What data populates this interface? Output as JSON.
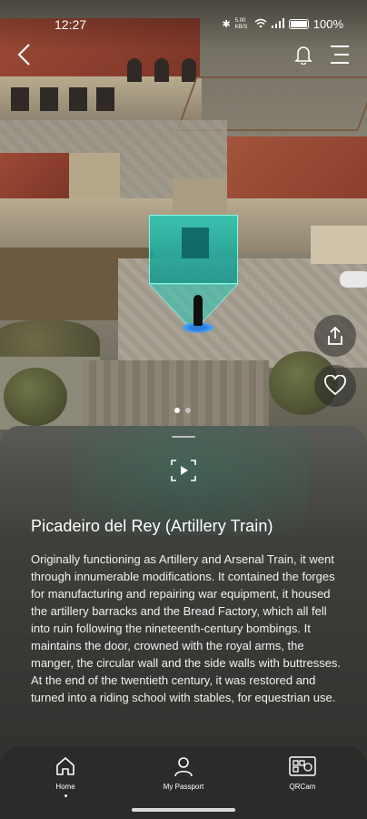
{
  "status_bar": {
    "time": "12:27",
    "network": "5.00 KB/S",
    "battery": "100%"
  },
  "hero": {
    "carousel_pages": 2,
    "active_page": 1
  },
  "sheet": {
    "title": "Picadeiro del Rey (Artillery Train)",
    "description": "Originally functioning as Artillery and Arsenal Train, it went through innumerable modifications. It contained the forges for manufacturing and repairing war equipment, it housed the artillery barracks and the Bread Factory, which all fell into ruin following the nineteenth-century bombings. It maintains the door, crowned with the royal arms, the manger, the circular wall and the side walls with buttresses. At the end of the twentieth century, it was restored and turned into a riding school with stables, for equestrian use."
  },
  "nav": {
    "items": [
      {
        "label": "Home",
        "icon": "home-icon",
        "active": true
      },
      {
        "label": "My Passport",
        "icon": "person-icon",
        "active": false
      },
      {
        "label": "QRCam",
        "icon": "qr-camera-icon",
        "active": false
      }
    ]
  },
  "colors": {
    "portal": "#2ec8b4",
    "marker": "#3d9bff",
    "sheet_bg": "#3e3e3b"
  }
}
